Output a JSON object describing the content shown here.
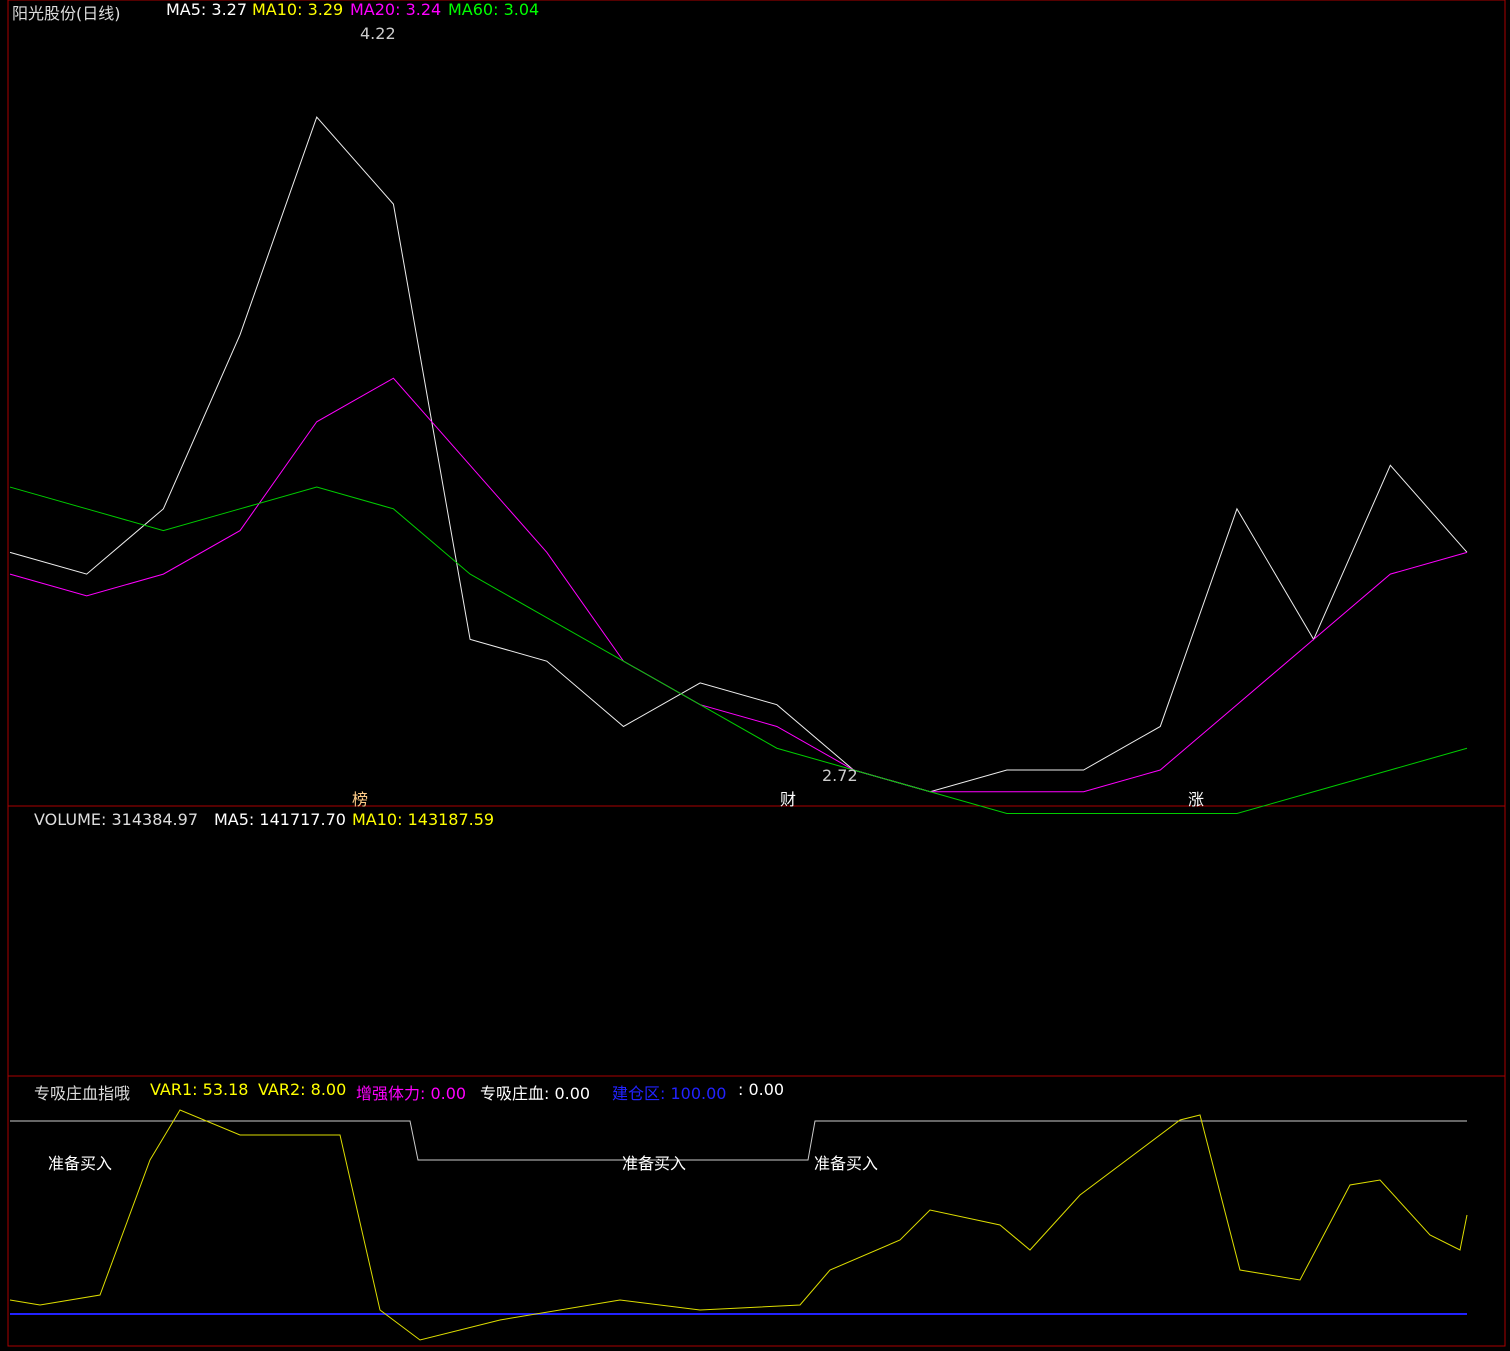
{
  "main": {
    "title": "阳光股份(日线)",
    "ma5": "MA5: 3.27",
    "ma10": "MA10: 3.29",
    "ma20": "MA20: 3.24",
    "ma60": "MA60: 3.04",
    "hi": "4.22",
    "lo": "2.72",
    "tags": [
      "榜",
      "财",
      "涨"
    ]
  },
  "vol": {
    "label": "VOLUME: 314384.97",
    "ma5": "MA5: 141717.70",
    "ma10": "MA10: 143187.59"
  },
  "ind": {
    "name": "专吸庄血指哦",
    "var1": "VAR1: 53.18",
    "var2": "VAR2: 8.00",
    "zq": "增强体力: 0.00",
    "zx": "专吸庄血: 0.00",
    "jc": "建仓区: 100.00",
    "v": ": 0.00",
    "buy": [
      "准备买入",
      "准备买入",
      "准备买入"
    ]
  },
  "chart_data": {
    "type": "line",
    "ma5": [
      3.1,
      3.05,
      3.2,
      3.6,
      4.1,
      3.9,
      2.9,
      2.85,
      2.7,
      2.8,
      2.75,
      2.6,
      2.55,
      2.6,
      2.6,
      2.7,
      3.2,
      2.9,
      3.3,
      3.1
    ],
    "ma20": [
      3.05,
      3.0,
      3.05,
      3.15,
      3.4,
      3.5,
      3.3,
      3.1,
      2.85,
      2.75,
      2.7,
      2.6,
      2.55,
      2.55,
      2.55,
      2.6,
      2.75,
      2.9,
      3.05,
      3.1
    ],
    "ma60": [
      3.25,
      3.2,
      3.15,
      3.2,
      3.25,
      3.2,
      3.05,
      2.95,
      2.85,
      2.75,
      2.65,
      2.6,
      2.55,
      2.5,
      2.5,
      2.5,
      2.5,
      2.55,
      2.6,
      2.65
    ],
    "ylim": [
      2.6,
      4.3
    ]
  }
}
